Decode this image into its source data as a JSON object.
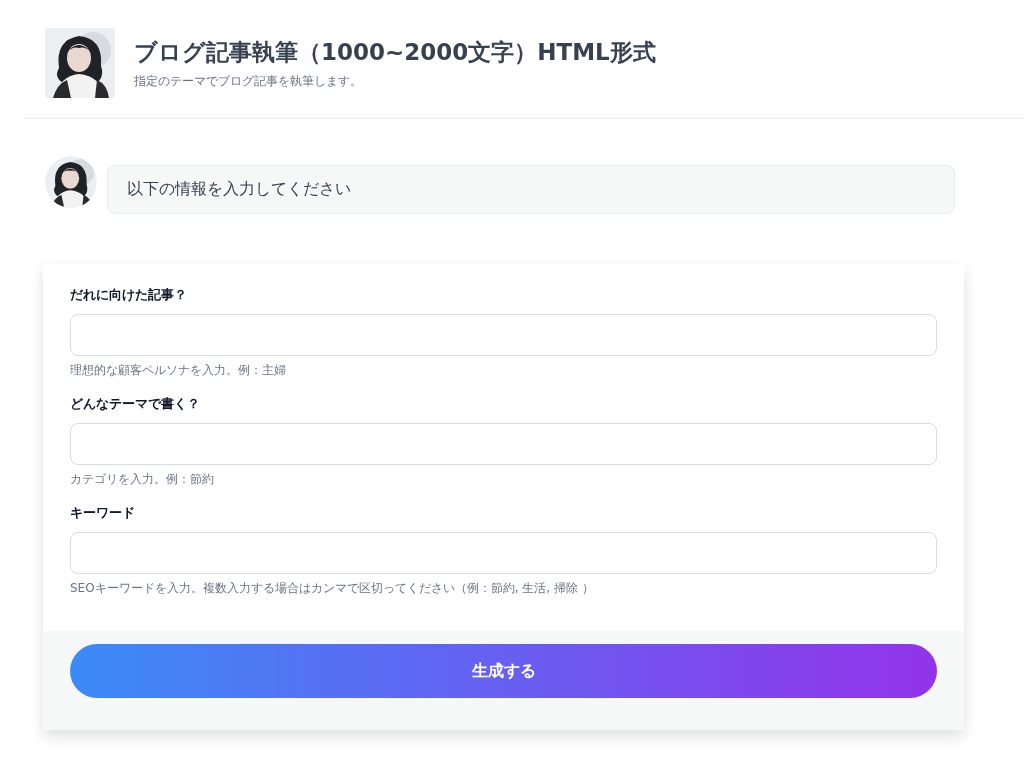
{
  "header": {
    "title": "ブログ記事執筆（1000~2000文字）HTML形式",
    "subtitle": "指定のテーマでブログ記事を執筆します。"
  },
  "message": {
    "text": "以下の情報を入力してください"
  },
  "form": {
    "fields": [
      {
        "label": "だれに向けた記事？",
        "hint": "理想的な顧客ペルソナを入力。例：主婦"
      },
      {
        "label": "どんなテーマで書く？",
        "hint": "カテゴリを入力。例：節約"
      },
      {
        "label": "キーワード",
        "hint": "SEOキーワードを入力。複数入力する場合はカンマで区切ってください（例：節約, 生活, 掃除 ）"
      }
    ],
    "submit": "生成する"
  }
}
